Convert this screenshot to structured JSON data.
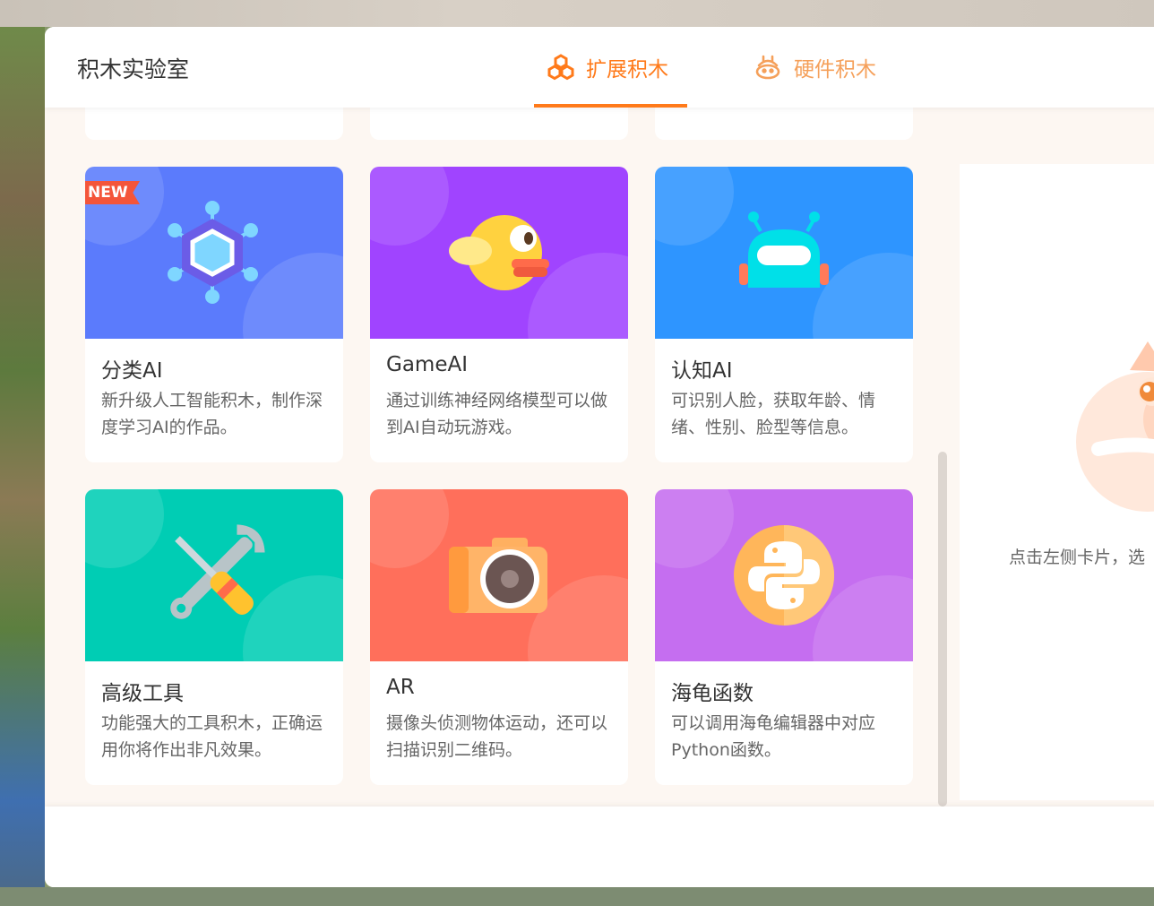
{
  "header": {
    "title": "积木实验室",
    "tabs": [
      {
        "label": "扩展积木",
        "icon": "hexagon-cluster-icon",
        "active": true
      },
      {
        "label": "硬件积木",
        "icon": "robot-hand-icon",
        "active": false
      }
    ]
  },
  "colors": {
    "accent": "#ff7a1a",
    "card_blue": "#5b7bfc",
    "card_purple": "#a044ff",
    "card_sky": "#2e95ff",
    "card_teal": "#00cdb4",
    "card_coral": "#ff6f5b",
    "card_violet": "#c56ef0"
  },
  "cards": [
    {
      "title": "分类AI",
      "desc": "新升级人工智能积木，制作深度学习AI的作品。",
      "badge": "NEW",
      "icon": "molecule-icon"
    },
    {
      "title": "GameAI",
      "desc": "通过训练神经网络模型可以做到AI自动玩游戏。",
      "icon": "flappy-bird-icon"
    },
    {
      "title": "认知AI",
      "desc": "可识别人脸，获取年龄、情绪、性别、脸型等信息。",
      "icon": "robot-icon"
    },
    {
      "title": "高级工具",
      "desc": "功能强大的工具积木，正确运用你将作出非凡效果。",
      "icon": "tools-icon"
    },
    {
      "title": "AR",
      "desc": "摄像头侦测物体运动，还可以扫描识别二维码。",
      "icon": "camera-icon"
    },
    {
      "title": "海龟函数",
      "desc": "可以调用海龟编辑器中对应Python函数。",
      "icon": "python-logo-icon"
    }
  ],
  "right_panel": {
    "hint": "点击左侧卡片，选"
  }
}
